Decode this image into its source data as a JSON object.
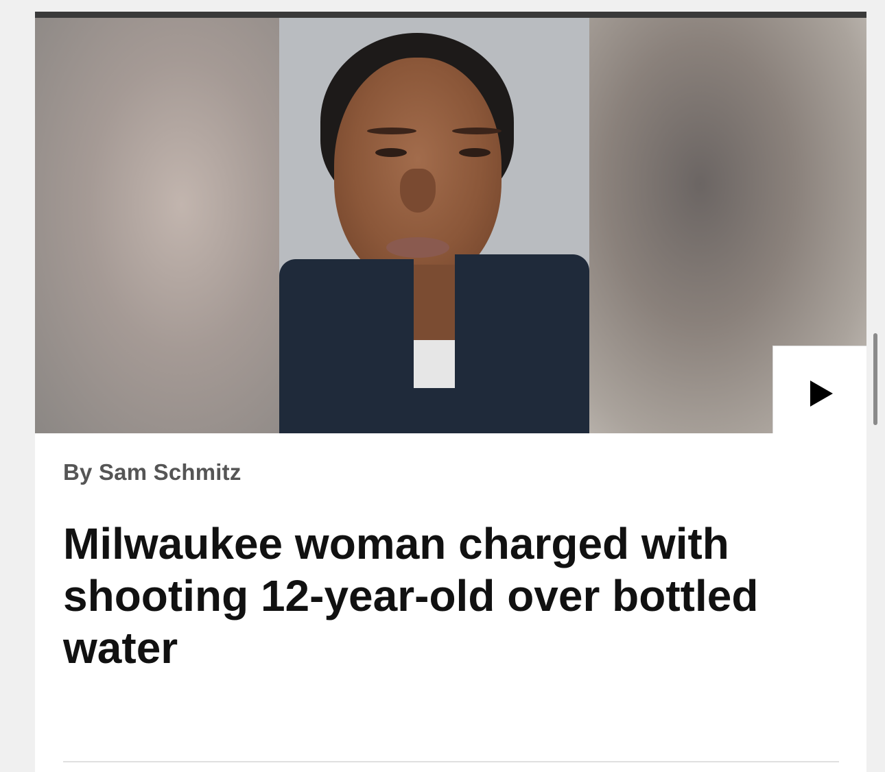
{
  "article": {
    "byline": "By Sam Schmitz",
    "headline": "Milwaukee woman charged with shooting 12-year-old over bottled water"
  },
  "media": {
    "image_subject": "booking photo",
    "play_icon": "play-icon"
  }
}
